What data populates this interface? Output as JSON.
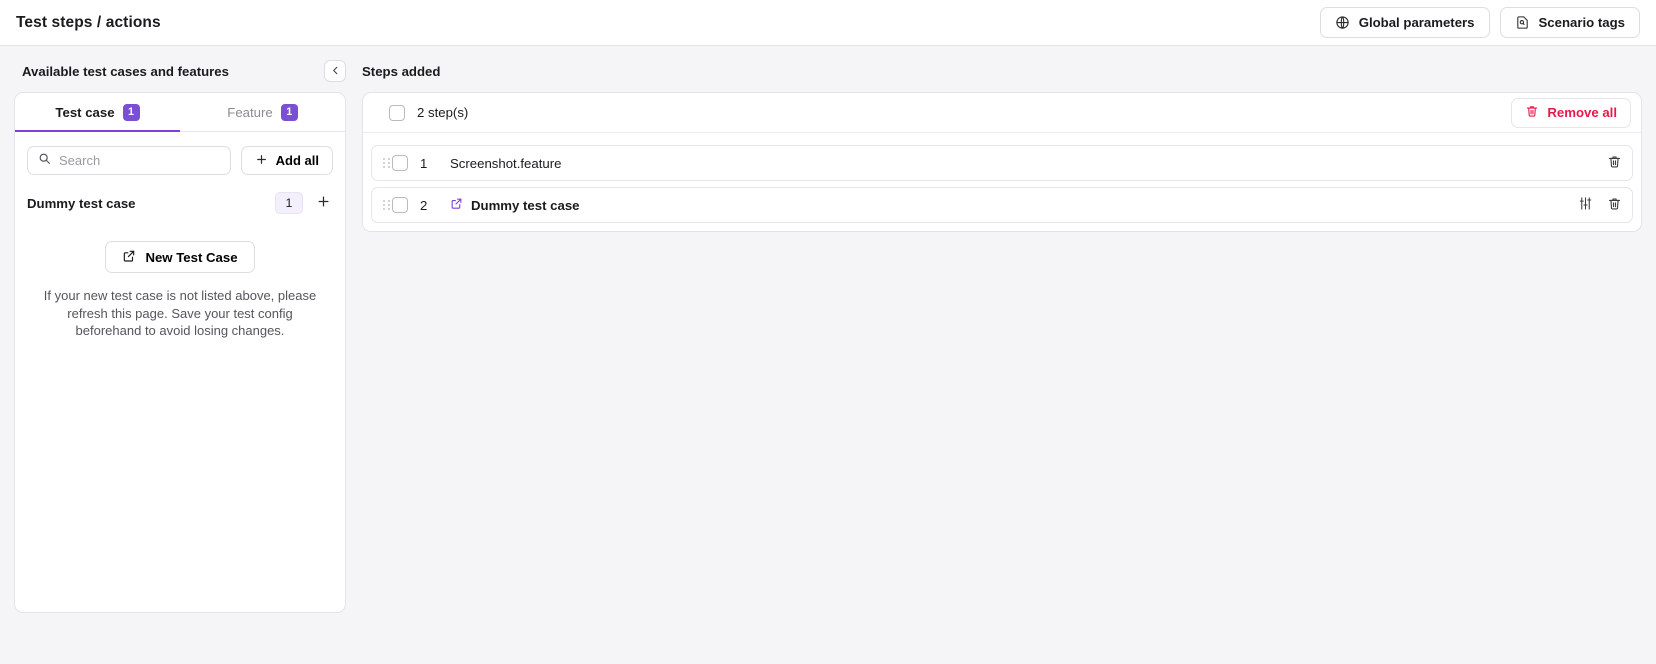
{
  "header": {
    "title": "Test steps / actions",
    "actions": [
      {
        "label": "Global parameters",
        "icon": "globe-icon"
      },
      {
        "label": "Scenario tags",
        "icon": "tag-document-icon"
      }
    ]
  },
  "left_panel": {
    "title": "Available test cases and features",
    "collapse_icon": "chevron-left-icon",
    "tabs": [
      {
        "label": "Test case",
        "badge": "1",
        "active": true
      },
      {
        "label": "Feature",
        "badge": "1",
        "active": false
      }
    ],
    "search": {
      "placeholder": "Search",
      "value": "",
      "icon": "search-icon"
    },
    "add_all_label": "Add all",
    "test_case": {
      "name": "Dummy test case",
      "count": "1"
    },
    "new_test_case_label": "New Test Case",
    "help_text": "If your new test case is not listed above, please refresh this page. Save your test config beforehand to avoid losing changes."
  },
  "right_panel": {
    "title": "Steps added",
    "step_count_label": "2 step(s)",
    "remove_all_label": "Remove all",
    "steps": [
      {
        "index": "1",
        "label": "Screenshot.feature",
        "has_link_icon": false,
        "has_params_icon": false
      },
      {
        "index": "2",
        "label": "Dummy test case",
        "has_link_icon": true,
        "has_params_icon": true
      }
    ]
  },
  "colors": {
    "accent_purple": "#7b3fe4",
    "badge_purple": "#7b4fd4",
    "danger_red": "#e8184a",
    "page_bg": "#f5f5f7"
  }
}
